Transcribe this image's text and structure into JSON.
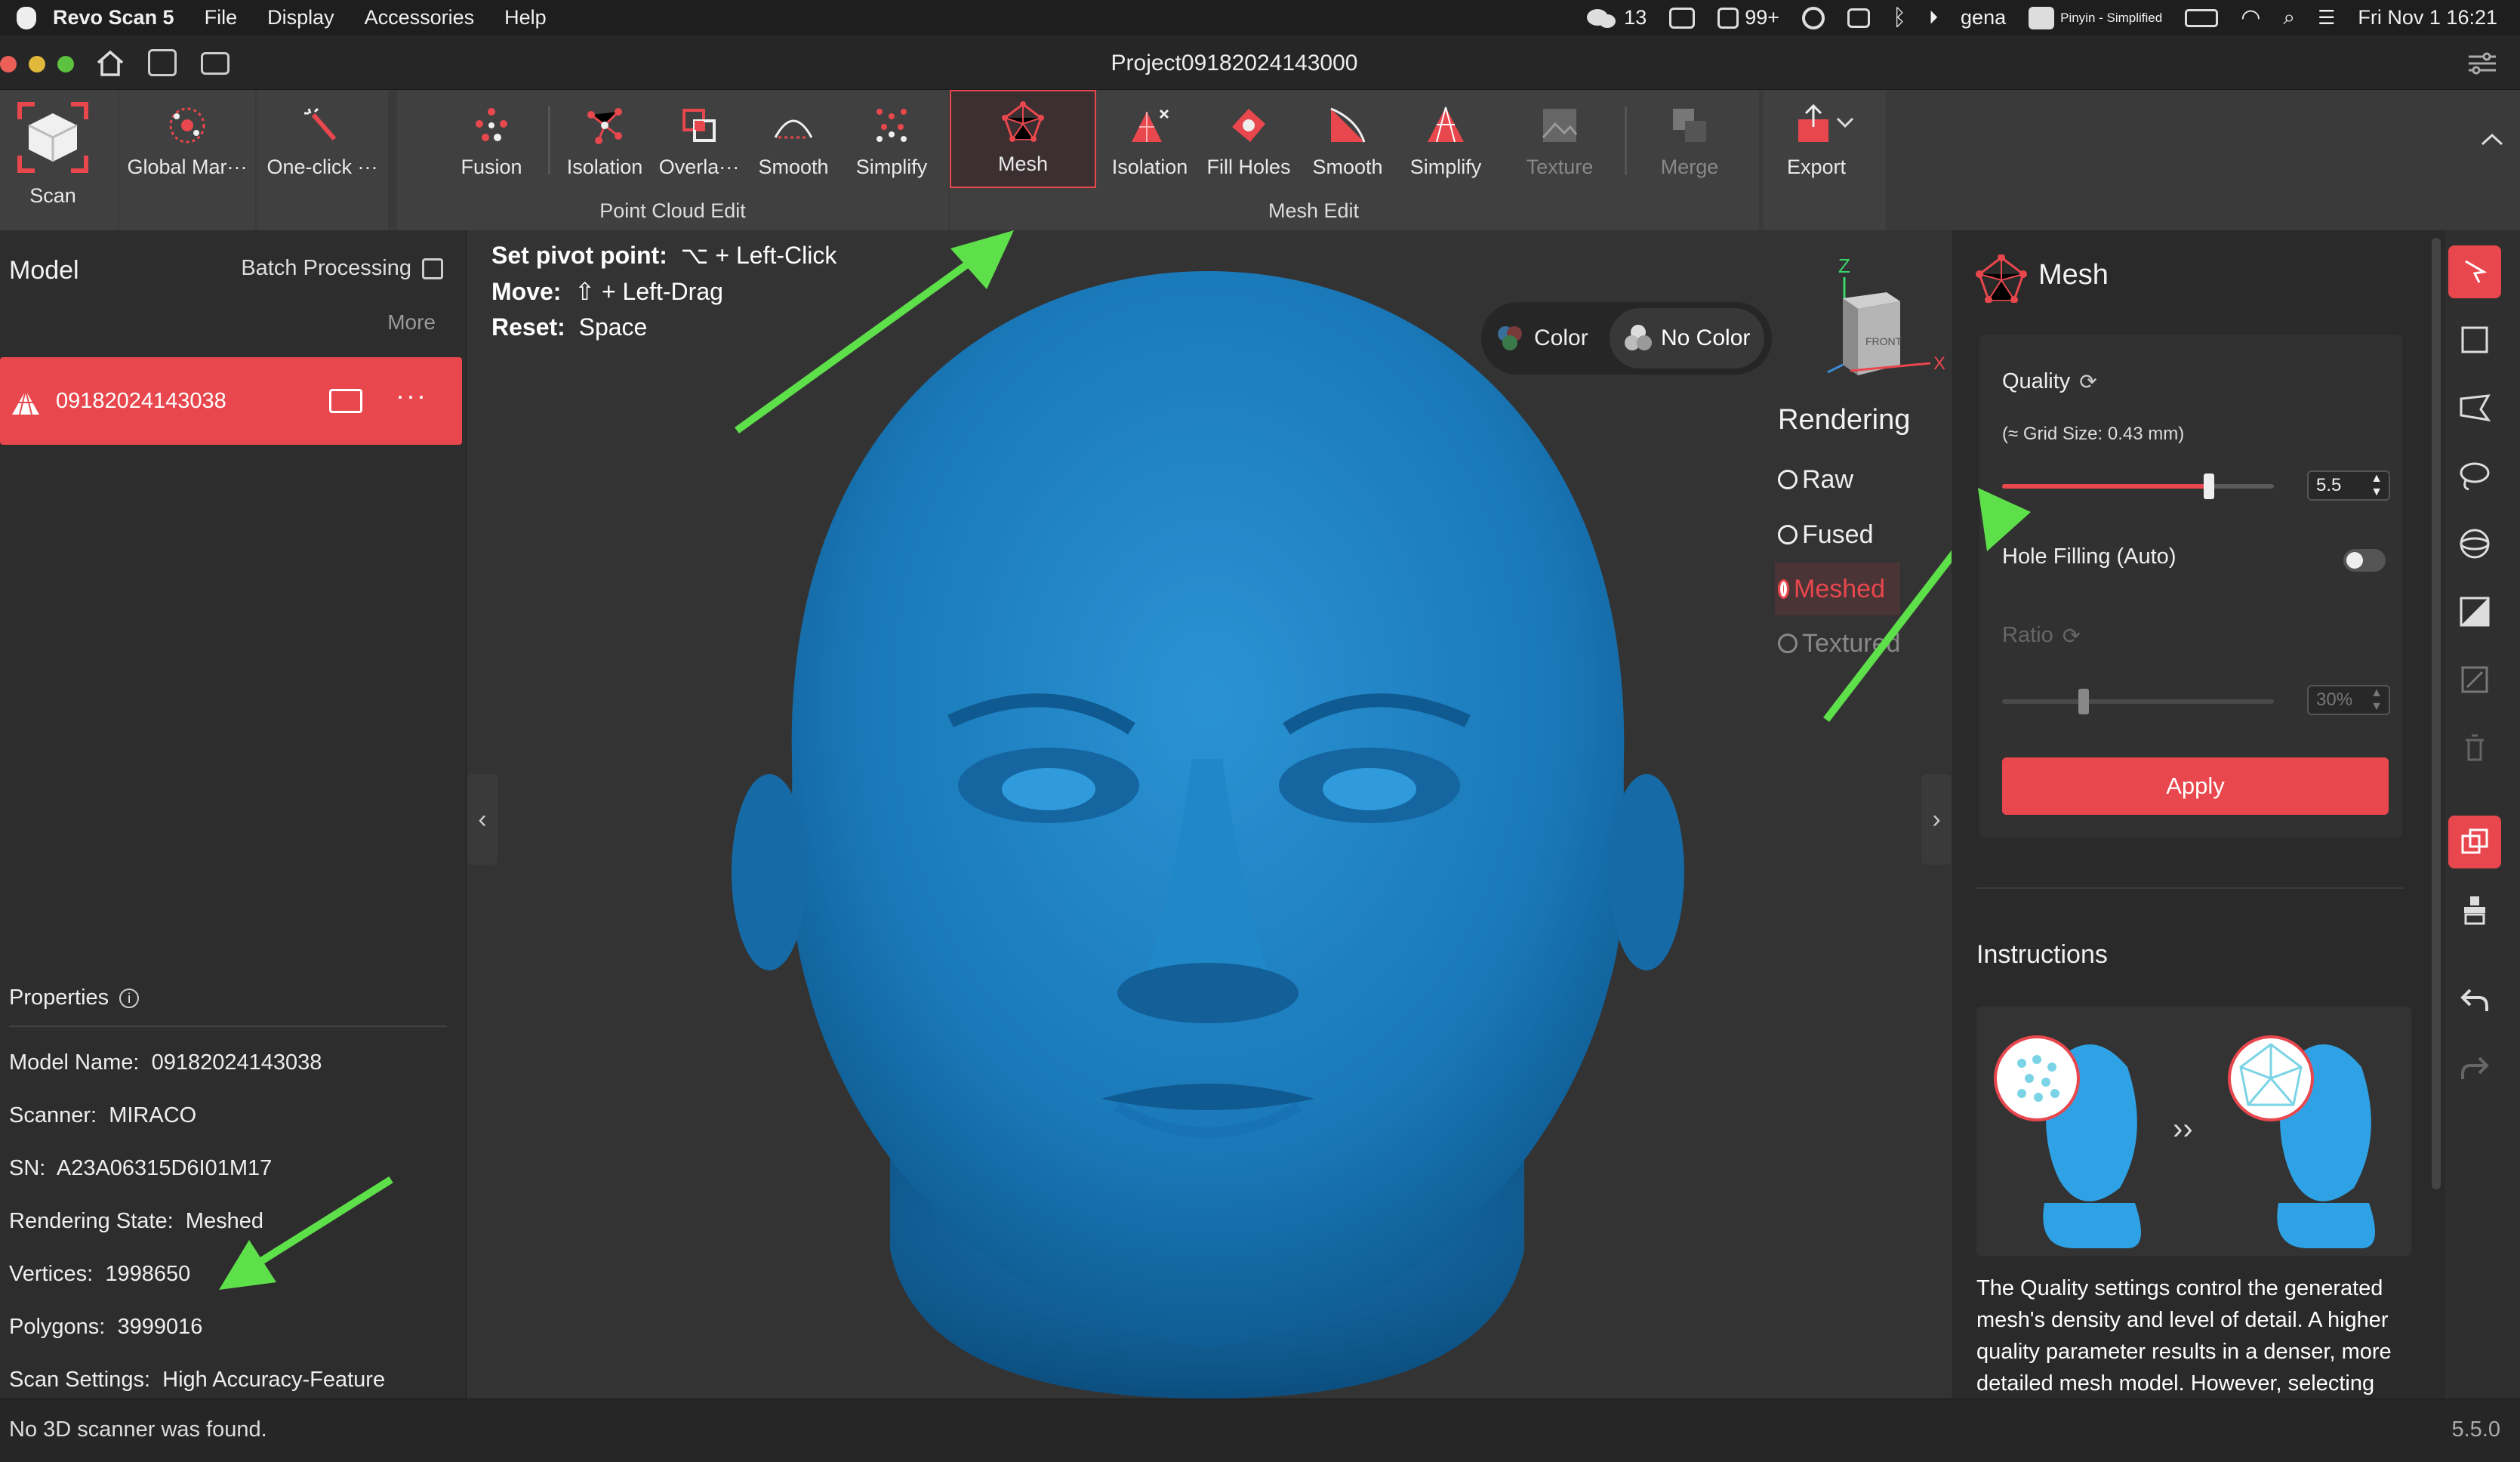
{
  "menubar": {
    "app_name": "Revo Scan 5",
    "menus": [
      "File",
      "Display",
      "Accessories",
      "Help"
    ],
    "wechat_count": "13",
    "badge_count": "99+",
    "user": "gena",
    "input_method": "Pinyin - Simplified",
    "datetime": "Fri Nov 1  16:21"
  },
  "titlebar": {
    "project": "Project09182024143000"
  },
  "toolbar": {
    "scan": "Scan",
    "global_markers": "Global Mar···",
    "one_click": "One-click ···",
    "point_cloud": {
      "label": "Point Cloud Edit",
      "buttons": [
        "Fusion",
        "Isolation",
        "Overla···",
        "Smooth",
        "Simplify"
      ]
    },
    "mesh_edit": {
      "label": "Mesh Edit",
      "buttons": [
        "Mesh",
        "Isolation",
        "Fill Holes",
        "Smooth",
        "Simplify"
      ]
    },
    "texture": "Texture",
    "merge": "Merge",
    "export": "Export"
  },
  "left_panel": {
    "title": "Model",
    "batch": "Batch Processing",
    "more": "More",
    "model_name": "09182024143038",
    "properties_title": "Properties",
    "properties": [
      {
        "label": "Model Name:",
        "value": "09182024143038"
      },
      {
        "label": "Scanner:",
        "value": "MIRACO"
      },
      {
        "label": "SN:",
        "value": "A23A06315D6I01M17"
      },
      {
        "label": "Rendering State:",
        "value": "Meshed"
      },
      {
        "label": "Vertices:",
        "value": "1998650"
      },
      {
        "label": "Polygons:",
        "value": "3999016"
      },
      {
        "label": "Scan Settings:",
        "value": "High Accuracy-Feature Tracking-General"
      }
    ]
  },
  "viewport": {
    "hints": [
      {
        "label": "Set pivot point:",
        "value": "⌥ + Left-Click"
      },
      {
        "label": "Move:",
        "value": "⇧ + Left-Drag"
      },
      {
        "label": "Reset:",
        "value": "Space"
      }
    ],
    "color_btn": "Color",
    "no_color_btn": "No Color",
    "axis_z": "Z",
    "axis_x": "X",
    "cube_face": "FRONT",
    "rendering_title": "Rendering",
    "rendering_options": [
      "Raw",
      "Fused",
      "Meshed",
      "Textured"
    ],
    "rendering_selected": "Meshed"
  },
  "right_panel": {
    "title": "Mesh",
    "quality_label": "Quality",
    "grid_size": "(≈ Grid Size: 0.43 mm)",
    "quality_value": "5.5",
    "quality_fraction": 0.76,
    "hole_filling": "Hole Filling (Auto)",
    "ratio_label": "Ratio",
    "ratio_value": "30%",
    "ratio_fraction": 0.3,
    "apply": "Apply",
    "instructions_title": "Instructions",
    "instructions_text": "The Quality settings control the generated mesh's density and level of detail. A higher quality parameter results in a denser, more detailed mesh model. However, selecting"
  },
  "status": {
    "message": "No 3D scanner was found.",
    "version": "5.5.0"
  },
  "colors": {
    "accent": "#e8474d",
    "mesh_blue": "#1d7fc0",
    "arrow": "#5ee04a"
  }
}
